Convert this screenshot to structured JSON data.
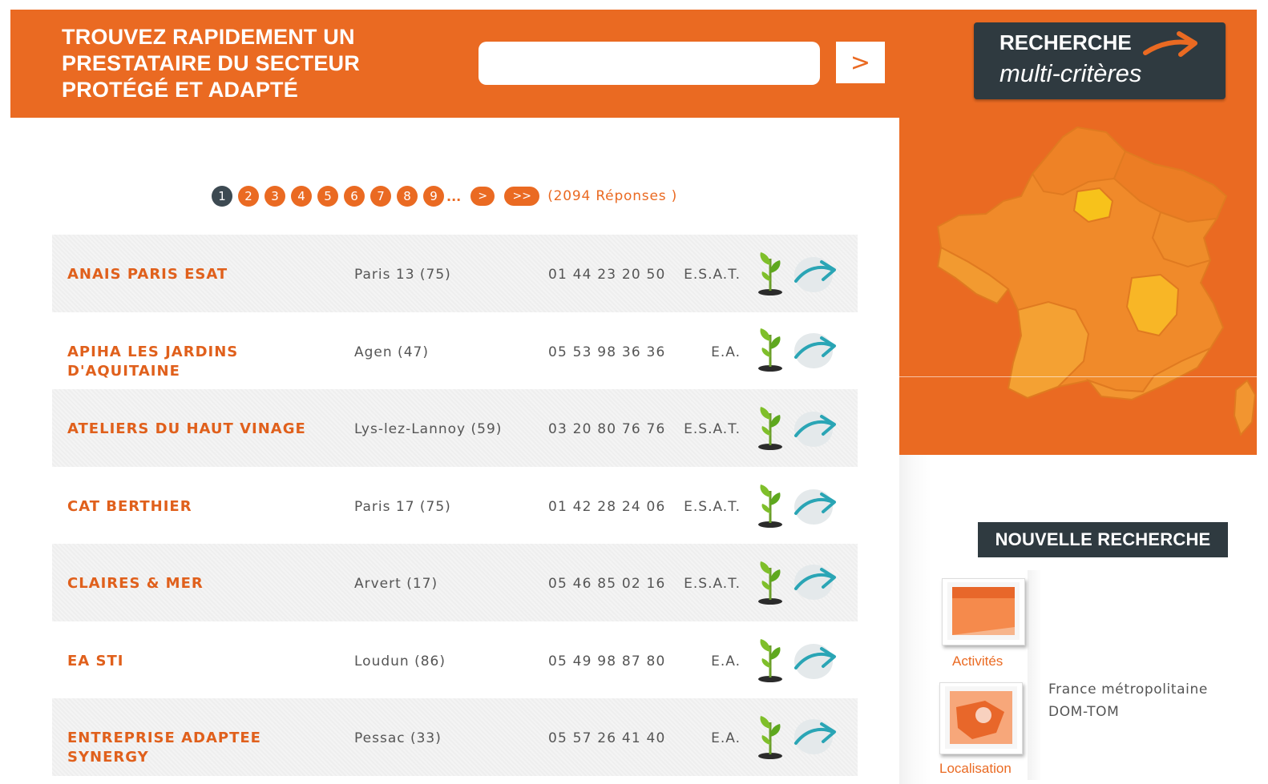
{
  "header": {
    "title_lines": [
      "TROUVEZ RAPIDEMENT UN",
      "PRESTATAIRE DU SECTEUR",
      "PROTÉGÉ ET ADAPTÉ"
    ],
    "search": {
      "value": "",
      "placeholder": ""
    },
    "search_button_label": ">",
    "multi_search": {
      "line1": "RECHERCHE",
      "line2": "multi-critères"
    }
  },
  "pagination": {
    "pages": [
      "1",
      "2",
      "3",
      "4",
      "5",
      "6",
      "7",
      "8",
      "9"
    ],
    "current": "1",
    "ellipsis": "...",
    "next_label": ">",
    "last_label": ">>",
    "count_text": "(2094 Réponses )"
  },
  "results": [
    {
      "name": "ANAIS PARIS ESAT",
      "city": "Paris 13 (75)",
      "phone": "01 44 23 20 50",
      "type": "E.S.A.T."
    },
    {
      "name": "APIHA LES JARDINS D'AQUITAINE",
      "city": "Agen (47)",
      "phone": "05 53 98 36 36",
      "type": "E.A."
    },
    {
      "name": "ATELIERS DU HAUT VINAGE",
      "city": "Lys-lez-Lannoy (59)",
      "phone": "03 20 80 76 76",
      "type": "E.S.A.T."
    },
    {
      "name": "CAT BERTHIER",
      "city": "Paris 17 (75)",
      "phone": "01 42 28 24 06",
      "type": "E.S.A.T."
    },
    {
      "name": "CLAIRES & MER",
      "city": "Arvert (17)",
      "phone": "05 46 85 02 16",
      "type": "E.S.A.T."
    },
    {
      "name": "EA STI",
      "city": "Loudun (86)",
      "phone": "05 49 98 87 80",
      "type": "E.A."
    },
    {
      "name": "ENTREPRISE ADAPTEE SYNERGY",
      "city": "Pessac (33)",
      "phone": "05 57 26 41 40",
      "type": "E.A."
    }
  ],
  "sidebar": {
    "new_search_label": "NOUVELLE RECHERCHE",
    "activities_label": "Activités",
    "localisation_label": "Localisation",
    "localisation_options": [
      "France métropolitaine",
      "DOM-TOM"
    ]
  },
  "colors": {
    "brand_orange": "#ea6a22",
    "dark_button": "#2f3a40",
    "active_page": "#3d4a52",
    "link_text": "#e0601c",
    "go_arrow": "#2aa5b5"
  },
  "icons": [
    "search-arrow-icon",
    "orange-arrow-icon",
    "france-map",
    "plant-icon",
    "go-arrow-icon",
    "activities-thumbnail",
    "localisation-thumbnail"
  ]
}
